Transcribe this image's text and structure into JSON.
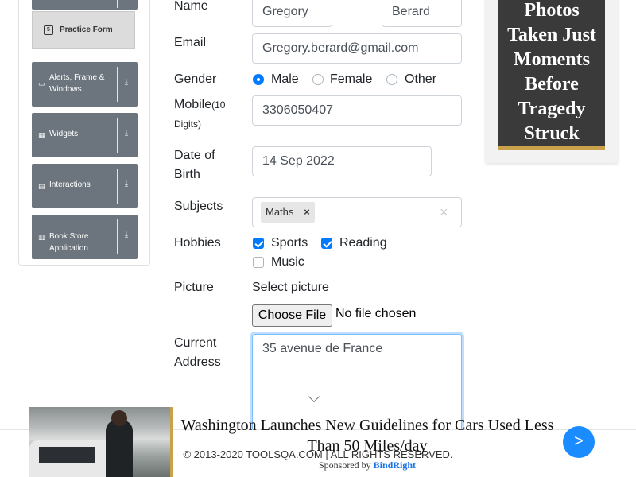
{
  "sidebar": {
    "active_item": {
      "label": "Practice Form",
      "icon": "html5-icon"
    },
    "groups": [
      {
        "label": "Alerts, Frame & Windows",
        "icon": "window-icon"
      },
      {
        "label": "Widgets",
        "icon": "widgets-icon"
      },
      {
        "label": "Interactions",
        "icon": "interactions-icon"
      },
      {
        "label": "Book Store Application",
        "icon": "book-icon"
      }
    ]
  },
  "form": {
    "name_label": "Name",
    "first_name": "Gregory",
    "last_name": "Berard",
    "email_label": "Email",
    "email": "Gregory.berard@gmail.com",
    "gender_label": "Gender",
    "gender_options": [
      "Male",
      "Female",
      "Other"
    ],
    "gender_selected": "Male",
    "mobile_label": "Mobile",
    "mobile_hint": "(10 Digits)",
    "mobile": "3306050407",
    "dob_label_1": "Date of",
    "dob_label_2": "Birth",
    "dob": "14 Sep 2022",
    "subjects_label": "Subjects",
    "subjects": [
      "Maths"
    ],
    "hobbies_label": "Hobbies",
    "hobbies": [
      {
        "label": "Sports",
        "checked": true
      },
      {
        "label": "Reading",
        "checked": true
      },
      {
        "label": "Music",
        "checked": false
      }
    ],
    "picture_label": "Picture",
    "select_picture": "Select picture",
    "choose_file": "Choose File",
    "no_file": "No file chosen",
    "address_label_1": "Current",
    "address_label_2": "Address",
    "address": "35 avenue de France"
  },
  "ad_right": {
    "text": "Photos Taken Just Moments Before Tragedy Struck"
  },
  "ad_bottom": {
    "headline": "Washington Launches New Guidelines for Cars Used Less Than 50 Miles/day",
    "sponsored_by": "Sponsored by",
    "brand": "BindRight",
    "next": ">"
  },
  "footer": {
    "copyright": "© 2013-2020 TOOLSQA.COM | ALL RIGHTS RESERVED."
  },
  "colors": {
    "accent": "#007bff",
    "sidebar_group": "#6c757d",
    "ad_gold": "#c8a14a"
  }
}
